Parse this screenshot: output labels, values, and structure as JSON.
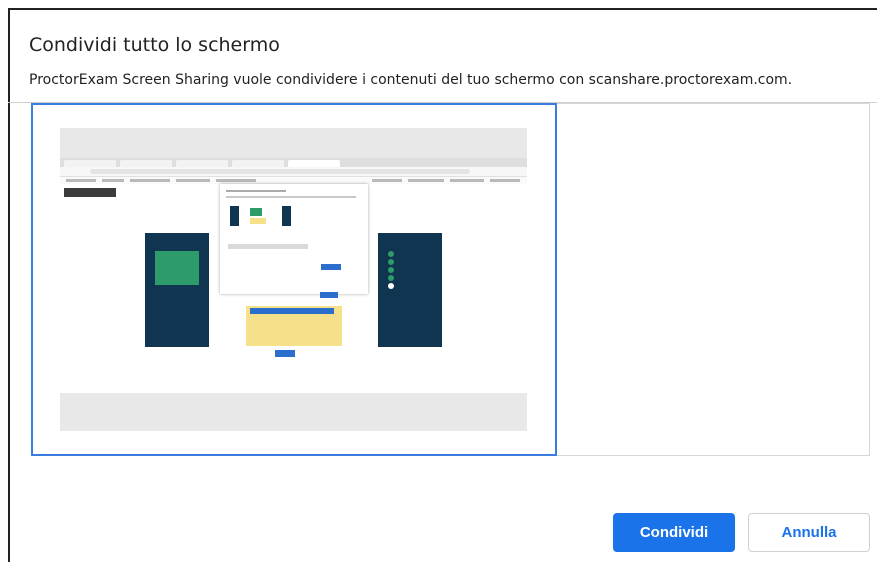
{
  "dialog": {
    "title": "Condividi tutto lo schermo",
    "description": "ProctorExam Screen Sharing vuole condividere i contenuti del tuo schermo con scanshare.proctorexam.com.",
    "share_label": "Condividi",
    "cancel_label": "Annulla"
  },
  "colors": {
    "accent": "#1a73e8",
    "selection_border": "#3b7ce0",
    "panel": "#0f3550"
  }
}
